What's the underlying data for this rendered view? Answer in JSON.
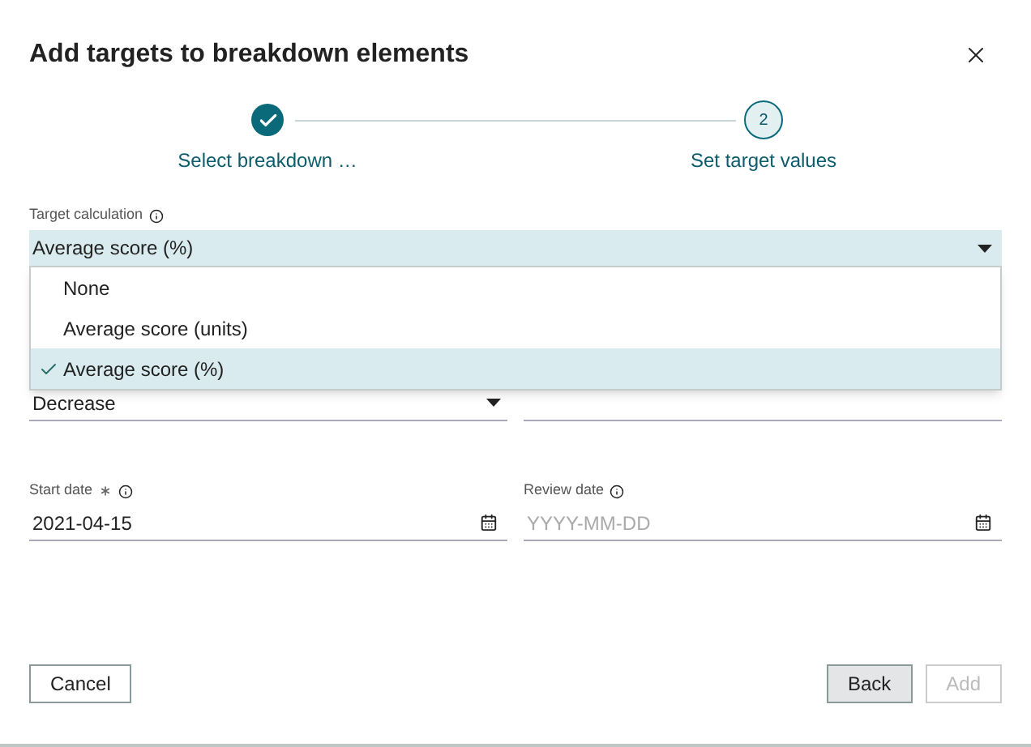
{
  "dialog": {
    "title": "Add targets to breakdown elements"
  },
  "steps": [
    {
      "label": "Select breakdown …",
      "completed": true
    },
    {
      "label": "Set target values",
      "number": "2",
      "completed": false
    }
  ],
  "target_calculation": {
    "label": "Target calculation",
    "value": "Average score (%)",
    "expanded": true,
    "options": [
      {
        "label": "None",
        "selected": false
      },
      {
        "label": "Average score (units)",
        "selected": false
      },
      {
        "label": "Average score (%)",
        "selected": true
      }
    ]
  },
  "row_fields": [
    {
      "kind": "select",
      "value": "Decrease"
    },
    {
      "kind": "text"
    }
  ],
  "date_fields": [
    {
      "label": "Start date",
      "required": true,
      "value": "2021-04-15"
    },
    {
      "label": "Review date",
      "required": false,
      "placeholder": "YYYY-MM-DD"
    }
  ],
  "buttons": [
    {
      "label": "Cancel",
      "highlighted": false,
      "disabled": false
    },
    {
      "label": "Back",
      "highlighted": true,
      "disabled": false
    },
    {
      "label": "Add",
      "highlighted": false,
      "disabled": true
    }
  ]
}
